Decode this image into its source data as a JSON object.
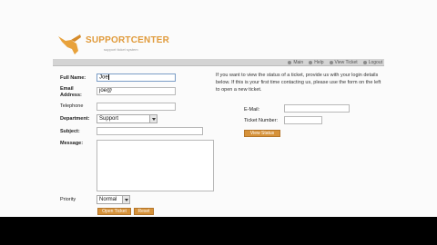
{
  "logo": {
    "name": "SUPPORTCENTER",
    "tagline": "support ticket system"
  },
  "nav": [
    {
      "label": "Main",
      "icon": "home-icon"
    },
    {
      "label": "Help",
      "icon": "help-icon"
    },
    {
      "label": "View Ticket",
      "icon": "ticket-icon"
    },
    {
      "label": "Logout",
      "icon": "logout-icon"
    }
  ],
  "form": {
    "full_name_label": "Full Name:",
    "full_name_value": "Joe",
    "email_label_1": "Email",
    "email_label_2": "Address:",
    "email_value": "joe@",
    "telephone_label": "Telephone",
    "telephone_value": "",
    "department_label": "Department:",
    "department_value": "Support",
    "subject_label": "Subject:",
    "subject_value": "",
    "message_label": "Message:",
    "priority_label": "Priority",
    "priority_value": "Normal",
    "open_ticket": "Open Ticket",
    "reset": "Reset"
  },
  "lookup": {
    "info": "If you want to view the status of a ticket, provide us with your login details below. If this is your first time contacting us, please use the form on the left to open a new ticket.",
    "email_label": "E-Mail:",
    "email_value": "",
    "ticket_label": "Ticket Number:",
    "ticket_value": "",
    "view_status": "View Status"
  },
  "colors": {
    "accent": "#d6923a",
    "logo": "#e09a3a",
    "navbar": "#d4d4d4"
  }
}
